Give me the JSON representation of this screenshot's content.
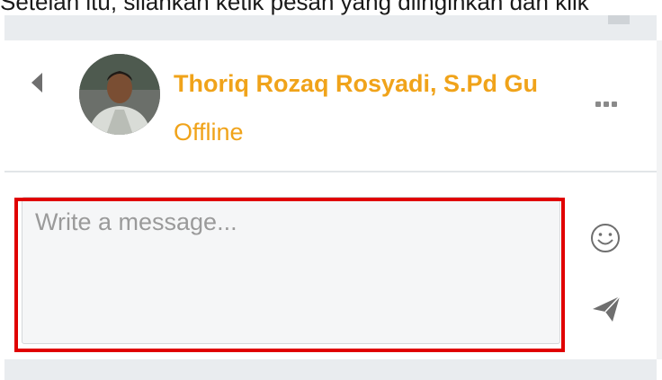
{
  "caption": {
    "text": "Setelah itu, silahkan ketik pesan yang diinginkan dan klik"
  },
  "contact": {
    "name": "Thoriq Rozaq Rosyadi, S.Pd Gu",
    "status": "Offline"
  },
  "composer": {
    "placeholder": "Write a message..."
  },
  "icons": {
    "back": "chevron-left-icon",
    "more": "more-dots-icon",
    "emoji": "smiley-icon",
    "send": "paper-plane-icon"
  },
  "colors": {
    "accent": "#f0a31a",
    "highlight": "#e00000",
    "icon": "#6f6f6f"
  }
}
